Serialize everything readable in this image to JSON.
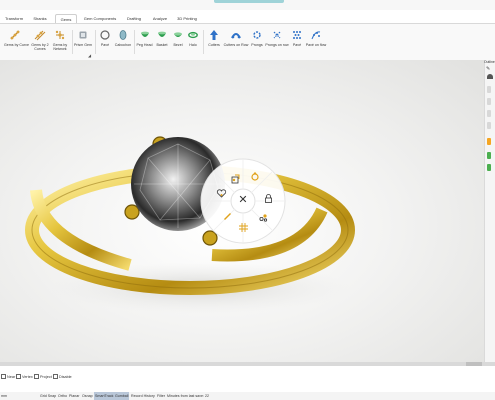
{
  "tabs": [
    {
      "label": "Transform"
    },
    {
      "label": "Shanks"
    },
    {
      "label": "Gems",
      "active": true
    },
    {
      "label": "Gem Components"
    },
    {
      "label": "Drafting"
    },
    {
      "label": "Analyze"
    },
    {
      "label": "3D Printing"
    }
  ],
  "ribbon": {
    "tools": [
      {
        "label": "Gems by Curve",
        "icon": "gem-curve-icon"
      },
      {
        "label": "Gems by 2\nCurves",
        "icon": "gem-two-curves-icon"
      },
      {
        "label": "Gems by\nNetwork",
        "icon": "gem-network-icon"
      },
      {
        "label": "Prism Gem",
        "icon": "prism-gem-icon"
      },
      {
        "label": "Pavé",
        "icon": "pave-icon"
      },
      {
        "label": "Cabochon",
        "icon": "cabochon-icon"
      },
      {
        "label": "Peg Head",
        "icon": "peg-head-icon"
      },
      {
        "label": "Basket",
        "icon": "basket-icon"
      },
      {
        "label": "Bezel",
        "icon": "bezel-icon"
      },
      {
        "label": "Halo",
        "icon": "halo-icon"
      },
      {
        "label": "Cutters",
        "icon": "cutters-icon"
      },
      {
        "label": "Cutters on Row",
        "icon": "cutters-on-row-icon"
      },
      {
        "label": "Prongs",
        "icon": "prongs-icon"
      },
      {
        "label": "Prongs on row",
        "icon": "prongs-on-row-icon"
      },
      {
        "label": "Pavé",
        "icon": "pave-grid-icon"
      },
      {
        "label": "Pavé on flow",
        "icon": "pave-on-flow-icon"
      }
    ]
  },
  "right_panel": {
    "label": "Outline"
  },
  "osnap": {
    "items": [
      {
        "label": "Near"
      },
      {
        "label": "Vertex"
      },
      {
        "label": "Project"
      },
      {
        "label": "Disable"
      }
    ]
  },
  "status": {
    "left": "mm",
    "grid_snap": "Grid Snap",
    "ortho": "Ortho",
    "planar": "Planar",
    "osnap": "Osnap",
    "smarttrack": "SmartTrack",
    "gumball": "Gumball",
    "record_history": "Record History",
    "filter": "Filter",
    "minutes": "Minutes from last save: 22"
  },
  "colors": {
    "gold": "#d9b829",
    "accent_orange": "#f5a623",
    "accent_green": "#4caf50",
    "panel_gray": "#f5f5f5"
  }
}
